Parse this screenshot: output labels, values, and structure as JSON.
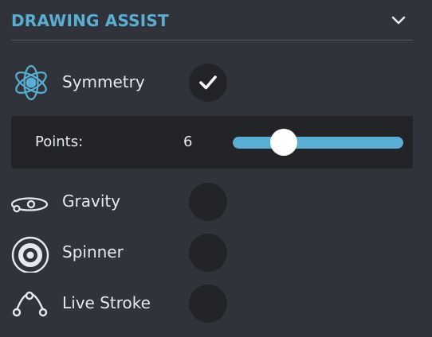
{
  "header": {
    "title": "DRAWING ASSIST",
    "chevron_icon": "chevron-down-icon"
  },
  "colors": {
    "accent": "#5aaed3",
    "background": "#30343a",
    "toggle_bg": "#222427",
    "text": "#e6e9ec"
  },
  "rows": {
    "symmetry": {
      "label": "Symmetry",
      "icon": "symmetry-flower-icon",
      "enabled": true
    },
    "gravity": {
      "label": "Gravity",
      "icon": "gravity-icon",
      "enabled": false
    },
    "spinner": {
      "label": "Spinner",
      "icon": "spinner-icon",
      "enabled": false
    },
    "live_stroke": {
      "label": "Live Stroke",
      "icon": "live-stroke-icon",
      "enabled": false
    }
  },
  "points": {
    "label": "Points:",
    "value": "6",
    "slider_fraction": 0.3
  }
}
